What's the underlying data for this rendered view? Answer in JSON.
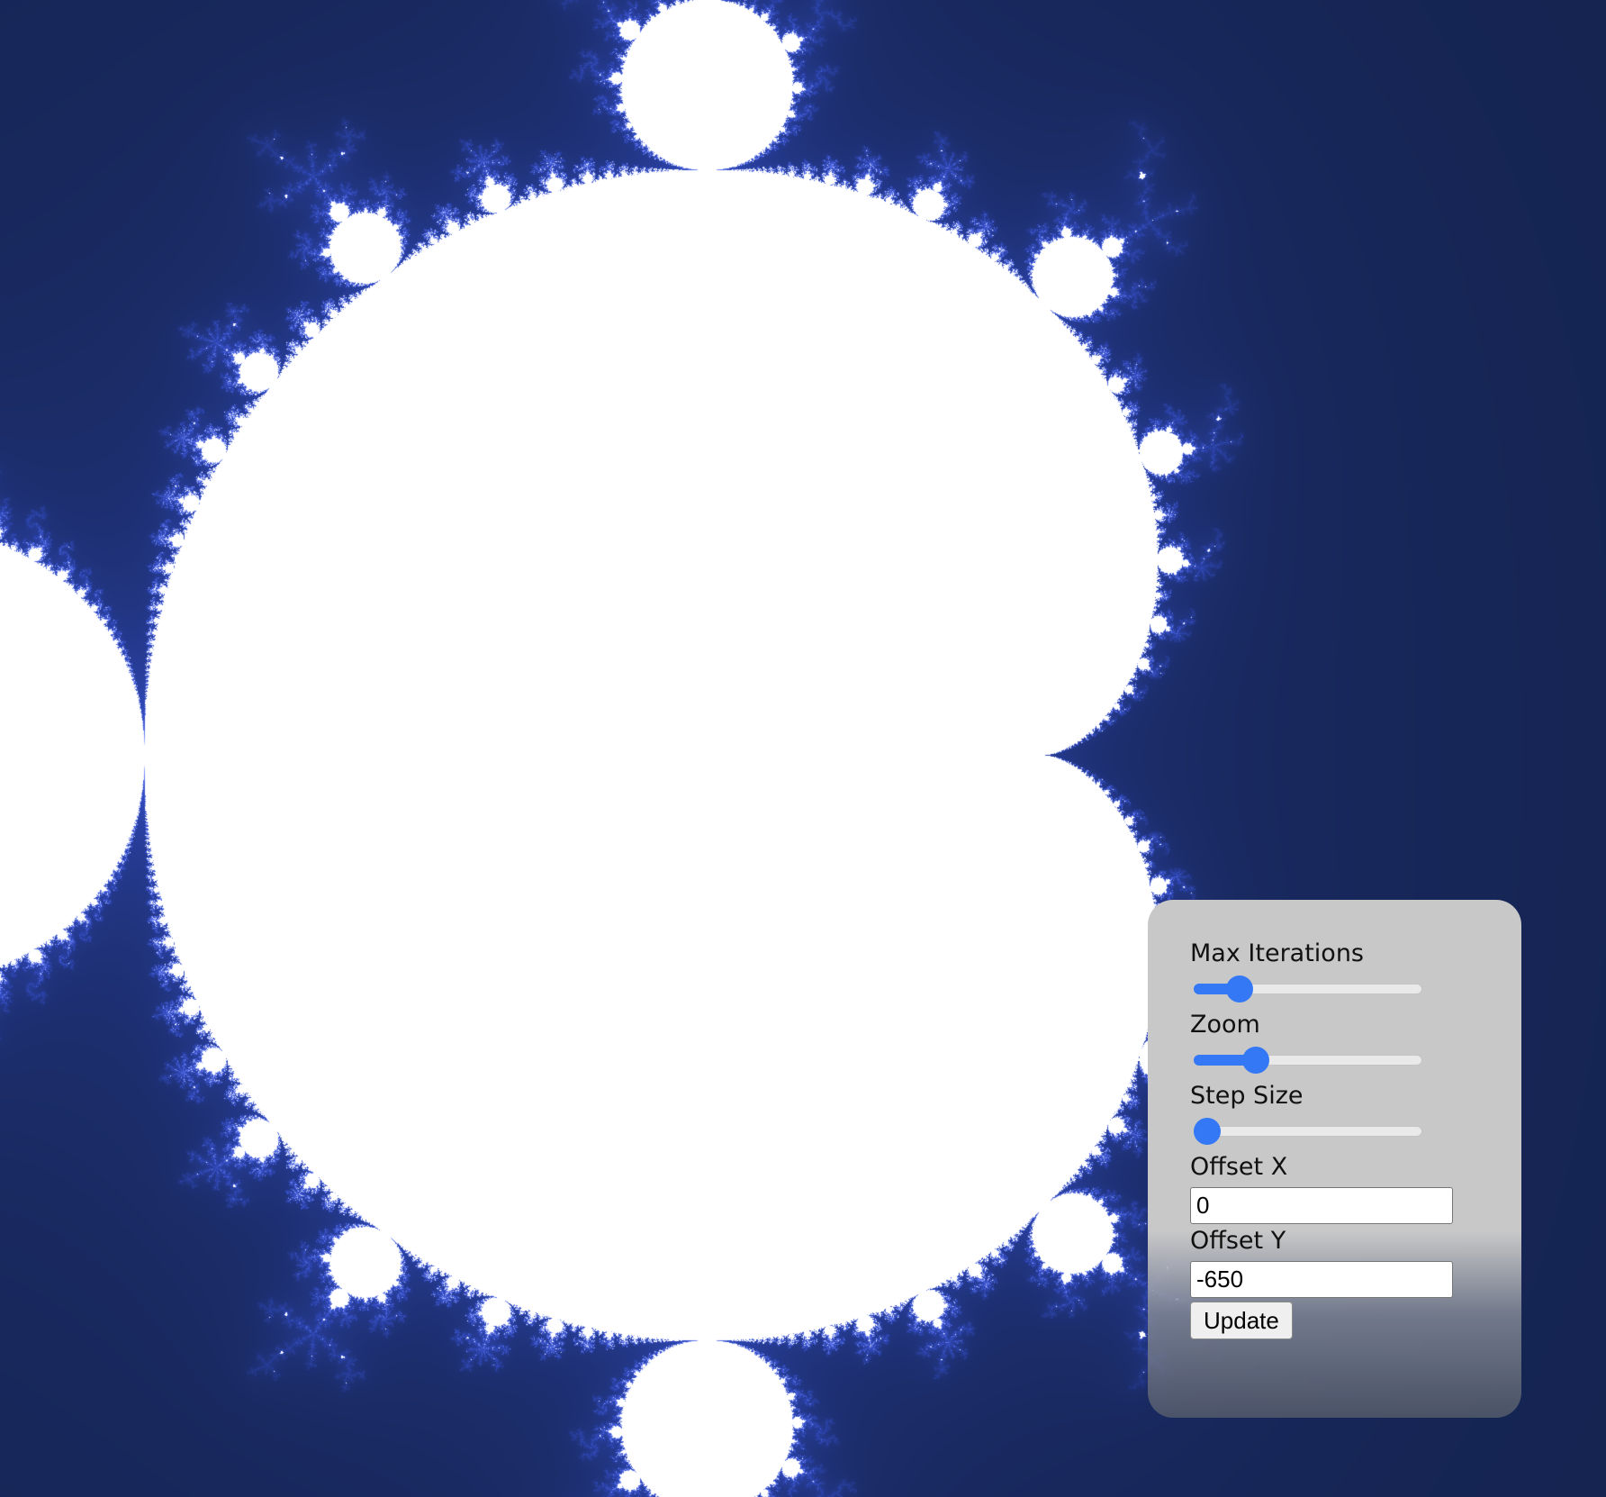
{
  "controls": {
    "max_iterations": {
      "label": "Max Iterations",
      "fraction": 0.16
    },
    "zoom": {
      "label": "Zoom",
      "fraction": 0.24
    },
    "step_size": {
      "label": "Step Size",
      "fraction": 0.0
    },
    "offset_x": {
      "label": "Offset X",
      "value": "0"
    },
    "offset_y": {
      "label": "Offset Y",
      "value": "-650"
    },
    "update_label": "Update"
  },
  "colors": {
    "background": "#061018",
    "fractal_edge": "#3a56e0",
    "set_interior": "#ffffff",
    "panel": "#c8c8c8",
    "slider_accent": "#3478f6"
  }
}
